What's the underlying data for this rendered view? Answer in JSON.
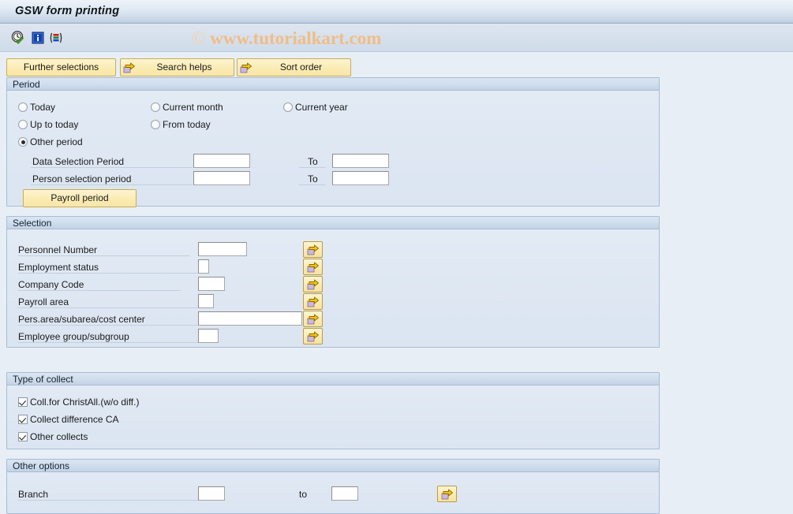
{
  "window": {
    "title": "GSW form printing"
  },
  "watermark": {
    "copyright": "©",
    "text": "www.tutorialkart.com"
  },
  "toolbar": {
    "icons": [
      {
        "name": "execute-clock-icon",
        "title": "Execute"
      },
      {
        "name": "information-icon",
        "title": "Information"
      },
      {
        "name": "variant-icon",
        "title": "Get Variant"
      }
    ]
  },
  "buttons": {
    "further_selections": "Further selections",
    "search_helps": "Search helps",
    "sort_order": "Sort order"
  },
  "period": {
    "header": "Period",
    "options": [
      {
        "label": "Today",
        "selected": false
      },
      {
        "label": "Current month",
        "selected": false
      },
      {
        "label": "Current year",
        "selected": false
      },
      {
        "label": "Up to today",
        "selected": false
      },
      {
        "label": "From today",
        "selected": false
      },
      {
        "label": "Other period",
        "selected": true
      }
    ],
    "rows": [
      {
        "label": "Data Selection Period",
        "value": "",
        "to_label": "To",
        "to_value": ""
      },
      {
        "label": "Person selection period",
        "value": "",
        "to_label": "To",
        "to_value": ""
      }
    ],
    "payroll_period_button": "Payroll period"
  },
  "selection": {
    "header": "Selection",
    "rows": [
      {
        "label": "Personnel Number",
        "value": ""
      },
      {
        "label": "Employment status",
        "value": ""
      },
      {
        "label": "Company Code",
        "value": ""
      },
      {
        "label": "Payroll area",
        "value": ""
      },
      {
        "label": "Pers.area/subarea/cost center",
        "value": ""
      },
      {
        "label": "Employee group/subgroup",
        "value": ""
      }
    ]
  },
  "type_of_collect": {
    "header": "Type of collect",
    "checkboxes": [
      {
        "label": "Coll.for ChristAll.(w/o diff.)",
        "checked": true
      },
      {
        "label": "Collect difference CA",
        "checked": true
      },
      {
        "label": "Other collects",
        "checked": true
      }
    ]
  },
  "other_options": {
    "header": "Other options",
    "rows": [
      {
        "label": "Branch",
        "value": "",
        "to_label": "to",
        "to_value": ""
      }
    ]
  },
  "colors": {
    "accent_yellow": "#f8e6a8",
    "panel_bg": "#dfe8f3",
    "page_bg": "#e8eef5",
    "watermark": "#f0bd86"
  }
}
